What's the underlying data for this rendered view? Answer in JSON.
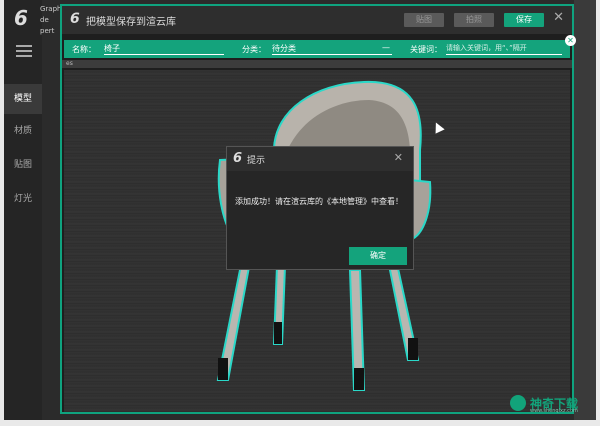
{
  "app": {
    "top_text_lines": [
      "Graph",
      "de",
      "pert"
    ],
    "sidebar": {
      "items": [
        {
          "label": "模型",
          "active": true
        },
        {
          "label": "材质",
          "active": false
        },
        {
          "label": "贴图",
          "active": false
        },
        {
          "label": "灯光",
          "active": false
        }
      ]
    }
  },
  "dialog": {
    "title": "把模型保存到渲云库",
    "buttons": {
      "prev": "贴图",
      "next": "拍照",
      "save": "保存"
    },
    "form": {
      "name_label": "名称：",
      "name_value": "椅子",
      "category_label": "分类：",
      "category_value": "待分类",
      "category_dropdown": "—",
      "keywords_label": "关键词：",
      "keywords_placeholder": "请输入关键词，用“、”隔开"
    },
    "sub_bar_text": "es"
  },
  "message": {
    "title": "提示",
    "text": "添加成功！请在渲云库的《本地管理》中查看！",
    "ok_label": "确定"
  },
  "watermark": {
    "text": "神奇下载",
    "sub": "www.shenqixz.com"
  },
  "colors": {
    "accent": "#14a37c",
    "outline": "#2ad8c8"
  }
}
